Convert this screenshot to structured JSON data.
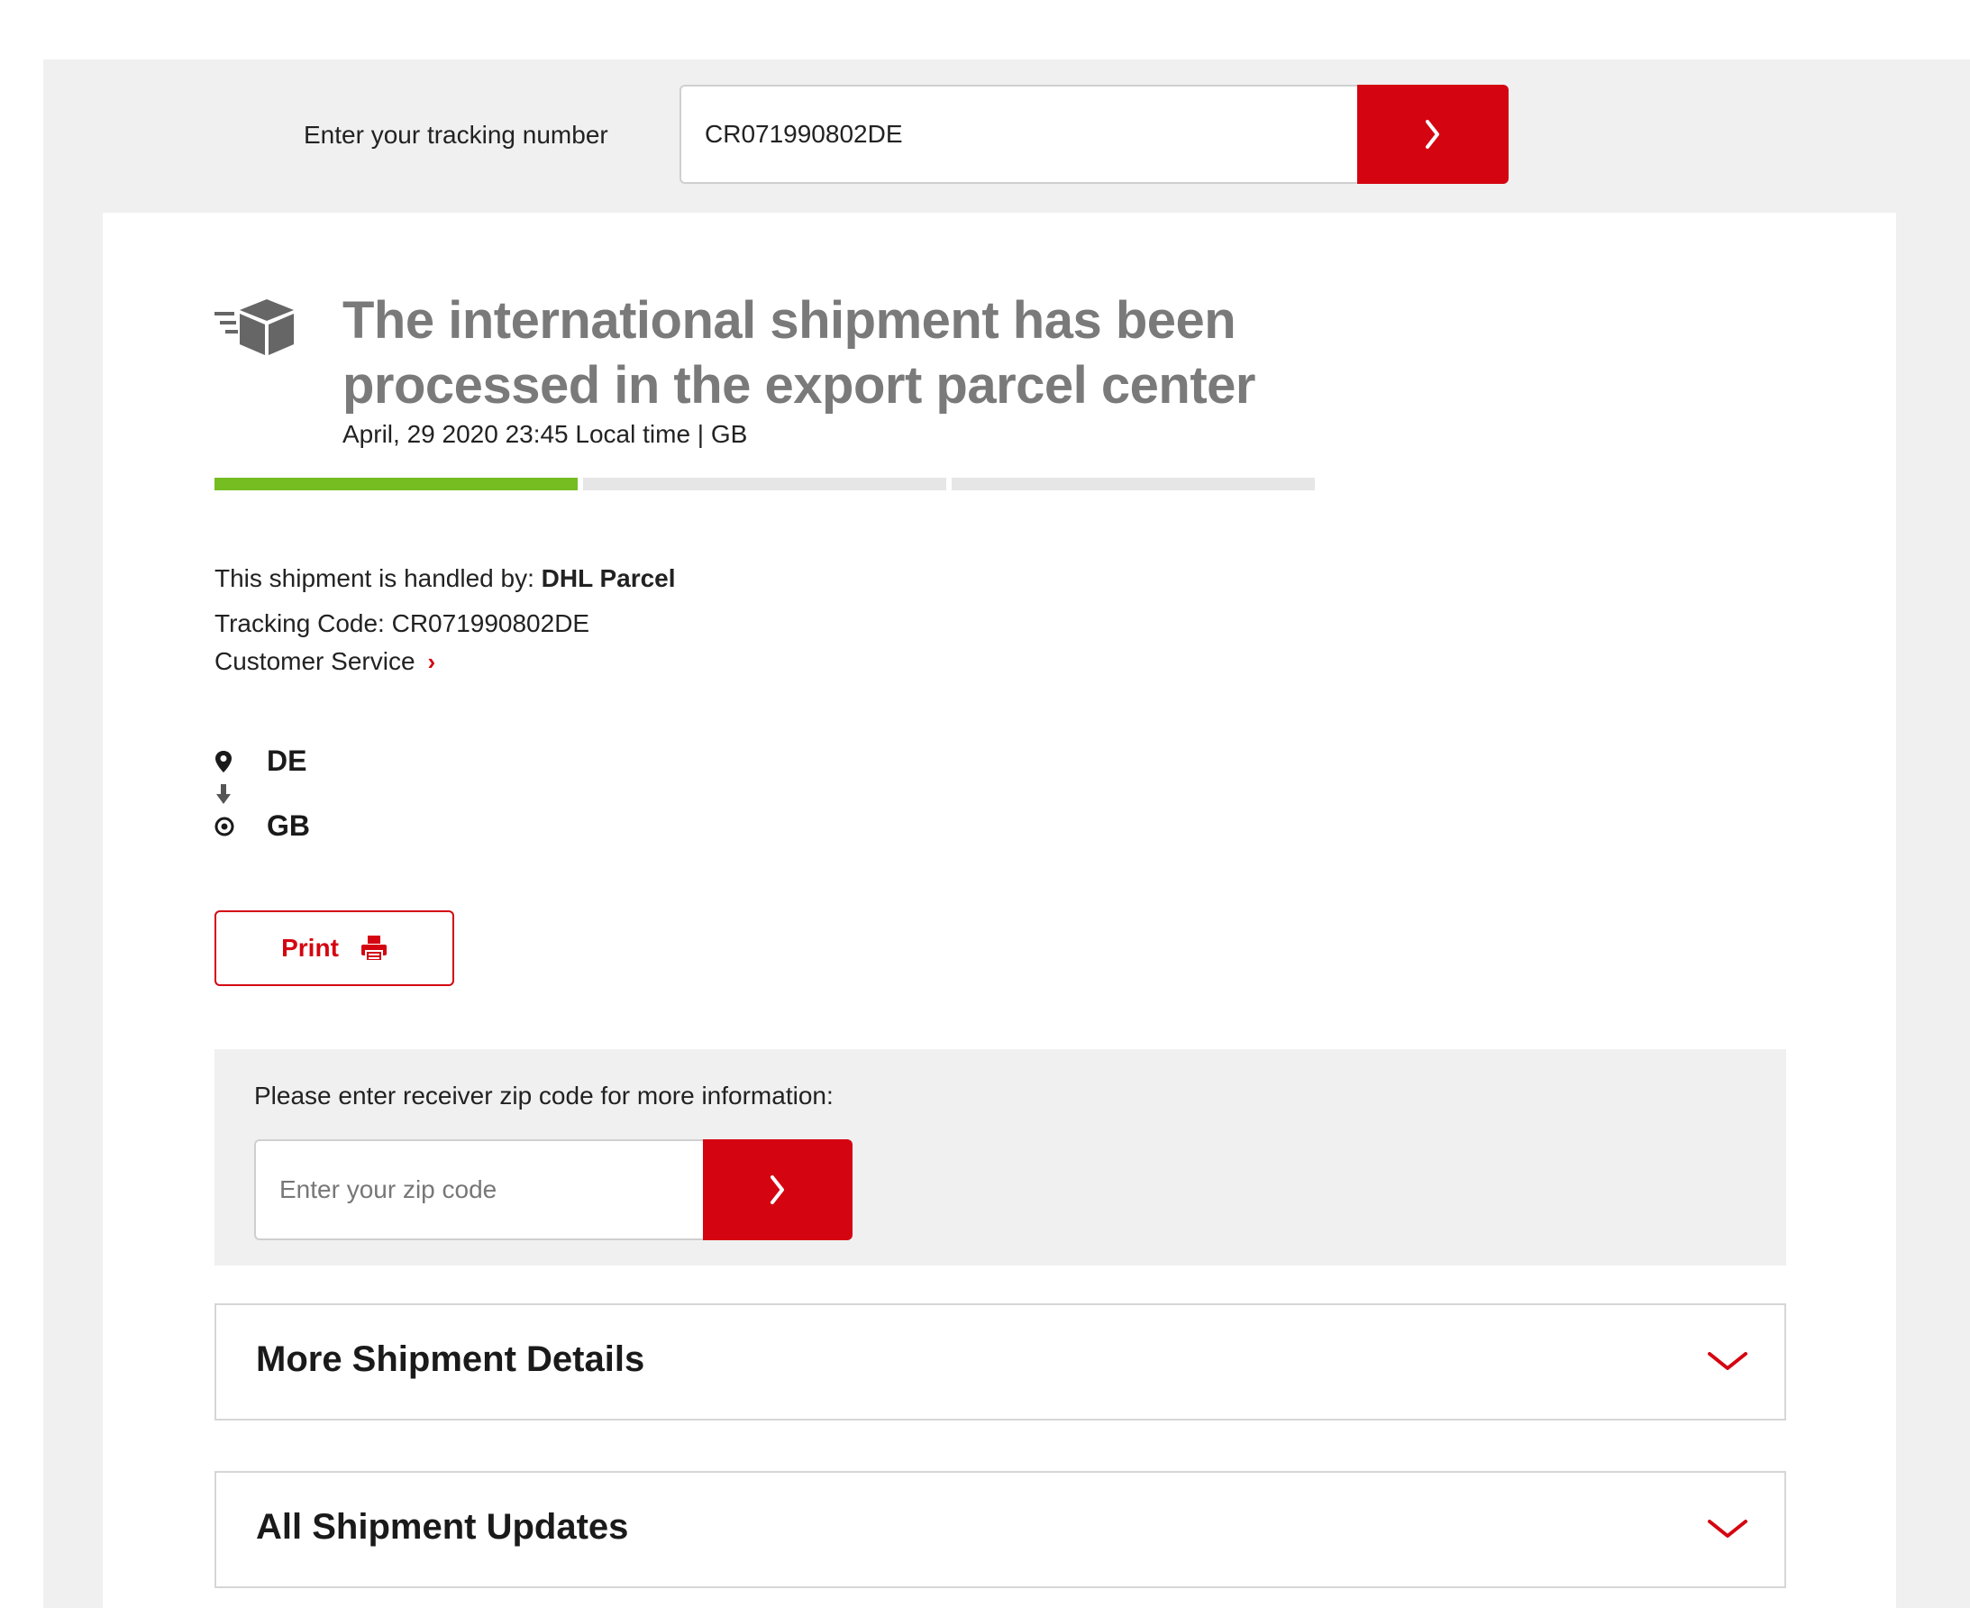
{
  "search": {
    "label": "Enter your tracking number",
    "value": "CR071990802DE",
    "submit_glyph": "›"
  },
  "status": {
    "title": "The international shipment has been processed in the export parcel center",
    "timestamp": "April, 29 2020 23:45 Local time | GB",
    "progress_steps": 3,
    "progress_completed": 1,
    "progress_color": "#76bd22"
  },
  "details": {
    "handled_by_label": "This shipment is handled by:",
    "handled_by_value": "DHL Parcel",
    "tracking_code_label": "Tracking Code:",
    "tracking_code_value": "CR071990802DE",
    "customer_service": "Customer Service",
    "customer_service_chev": "›"
  },
  "route": {
    "origin": "DE",
    "destination": "GB"
  },
  "print": {
    "label": "Print"
  },
  "zip": {
    "label": "Please enter receiver zip code for more information:",
    "placeholder": "Enter your zip code",
    "submit_glyph": "›"
  },
  "accordions": [
    {
      "title": "More Shipment Details"
    },
    {
      "title": "All Shipment Updates"
    }
  ],
  "colors": {
    "brand_red": "#d40511",
    "panel_gray": "#f0f0f0",
    "title_gray": "#7a7a7a"
  }
}
